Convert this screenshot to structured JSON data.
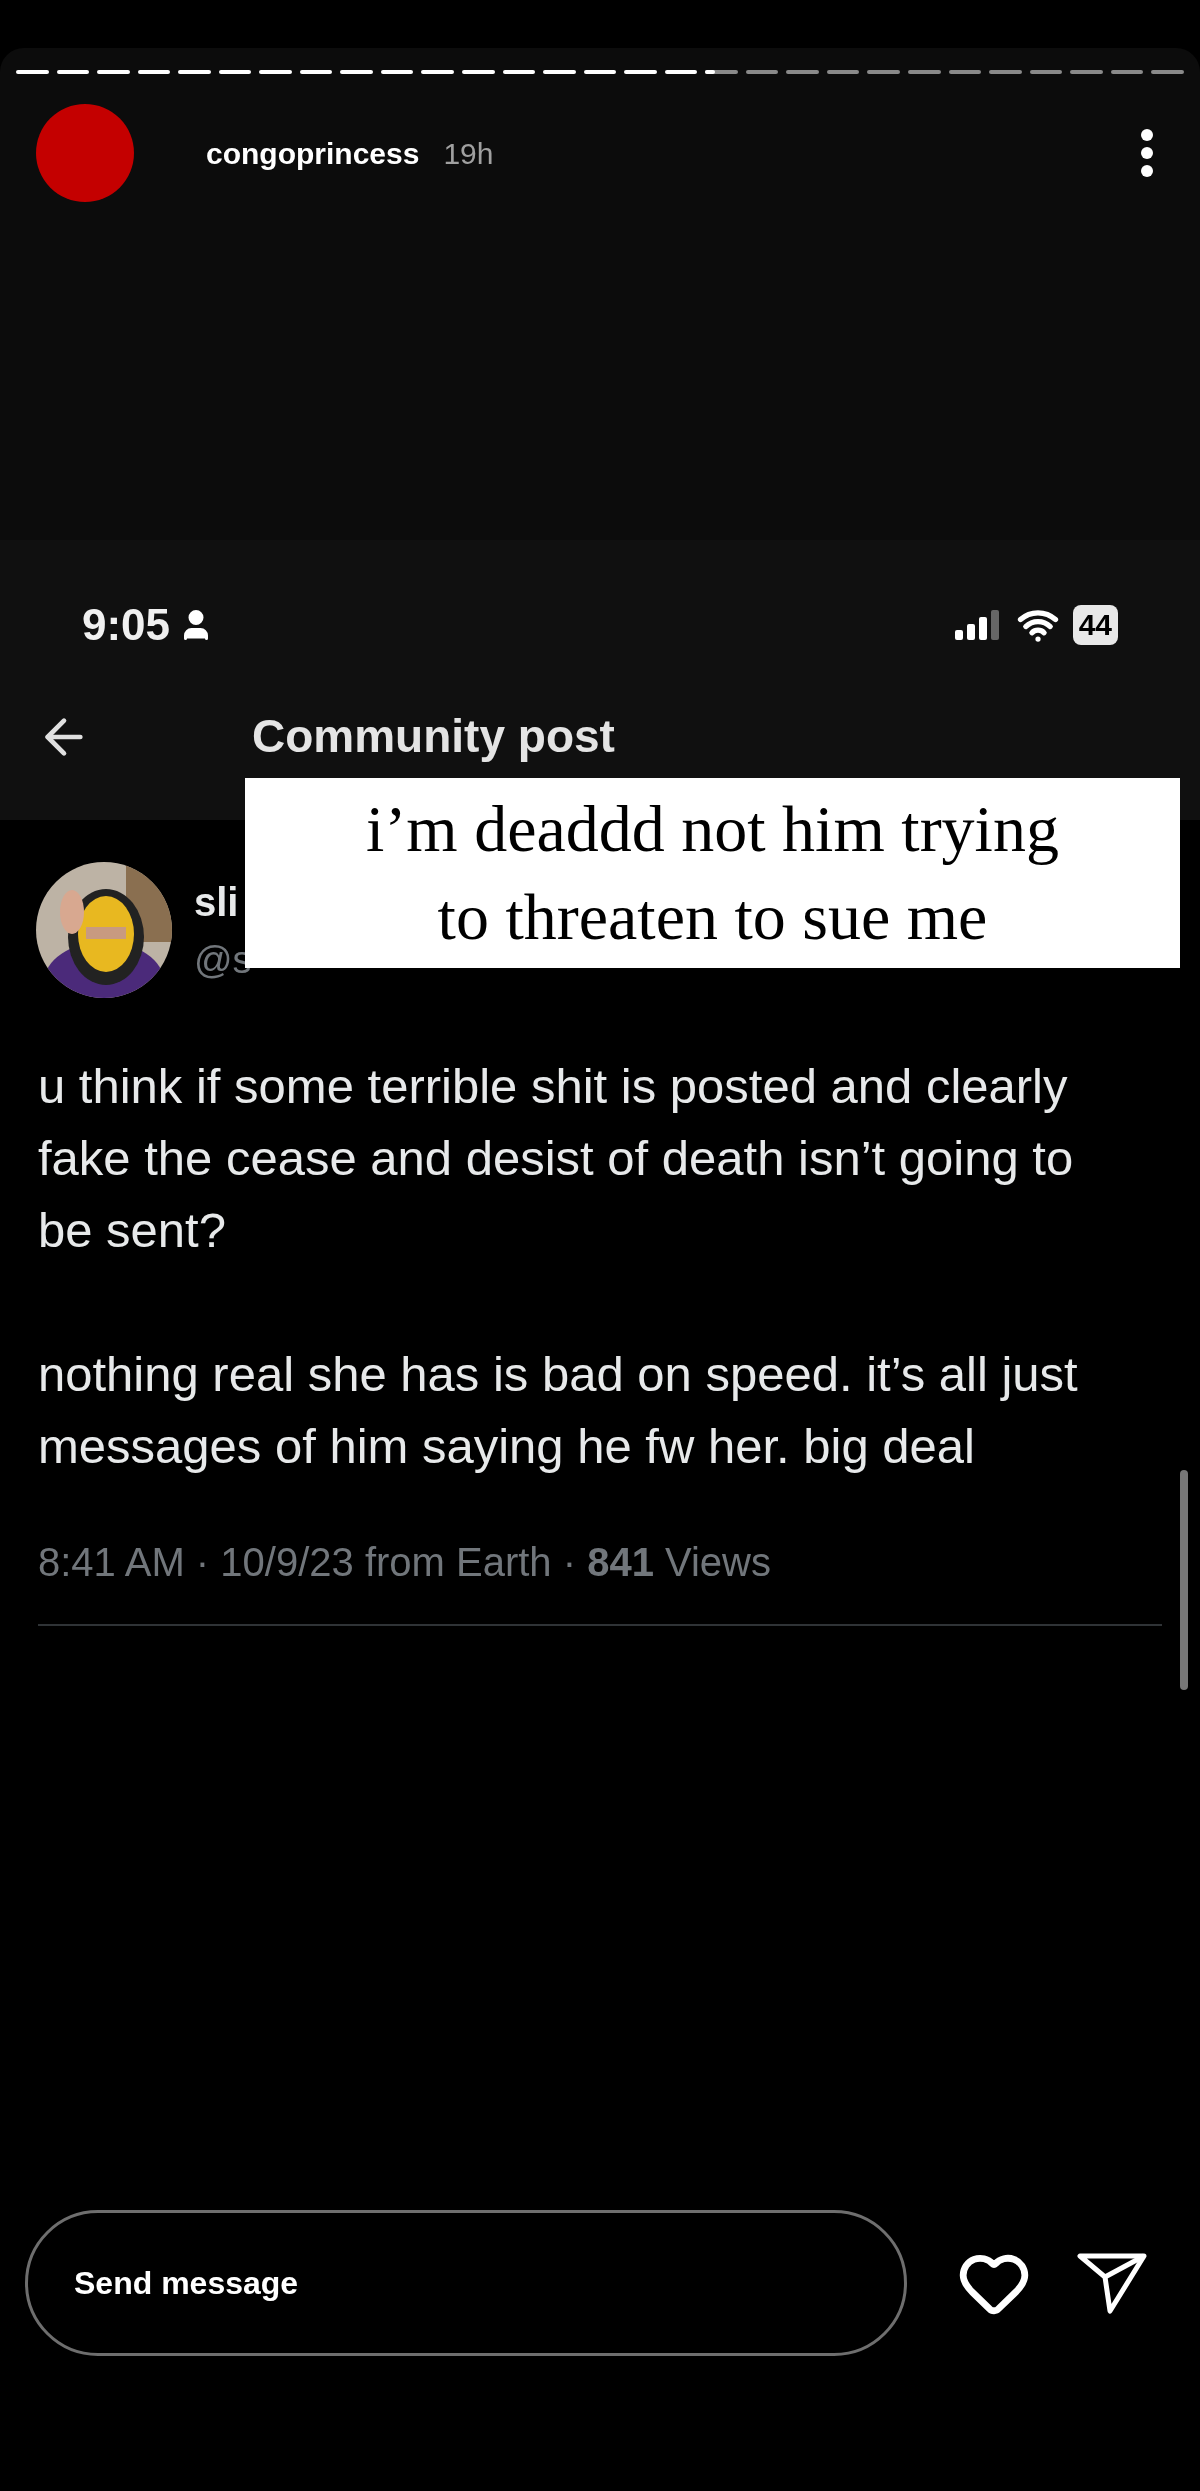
{
  "story_progress": [
    {
      "seen": true
    },
    {
      "seen": true
    },
    {
      "seen": true
    },
    {
      "seen": true
    },
    {
      "seen": true
    },
    {
      "seen": true
    },
    {
      "seen": true
    },
    {
      "seen": true
    },
    {
      "seen": true
    },
    {
      "seen": true
    },
    {
      "seen": true
    },
    {
      "seen": true
    },
    {
      "seen": true
    },
    {
      "seen": true
    },
    {
      "seen": true
    },
    {
      "seen": true
    },
    {
      "seen": true
    },
    {
      "seen": false,
      "level": 0.3
    },
    {
      "seen": false
    },
    {
      "seen": false
    },
    {
      "seen": false
    },
    {
      "seen": false
    },
    {
      "seen": false
    },
    {
      "seen": false
    },
    {
      "seen": false
    },
    {
      "seen": false
    },
    {
      "seen": false
    },
    {
      "seen": false
    },
    {
      "seen": false
    }
  ],
  "story_header": {
    "username": "congoprincess",
    "time": "19h"
  },
  "screenshot": {
    "status_bar": {
      "time": "9:05",
      "battery": "44"
    },
    "title": "Community post",
    "post": {
      "name": "sli",
      "handle": "@s",
      "paragraphs": [
        "u think if some terrible shit is posted and clearly fake the cease and desist of death isn’t going to be sent?",
        "nothing real she has is bad on speed. it’s all just messages of him saying he fw her. big deal"
      ],
      "meta": "8:41 AM · 10/9/23 from Earth · **841** Views"
    }
  },
  "caption": [
    "i’m deaddd not him trying",
    "to threaten to sue me"
  ],
  "reply_bar": {
    "placeholder": "Send message"
  }
}
